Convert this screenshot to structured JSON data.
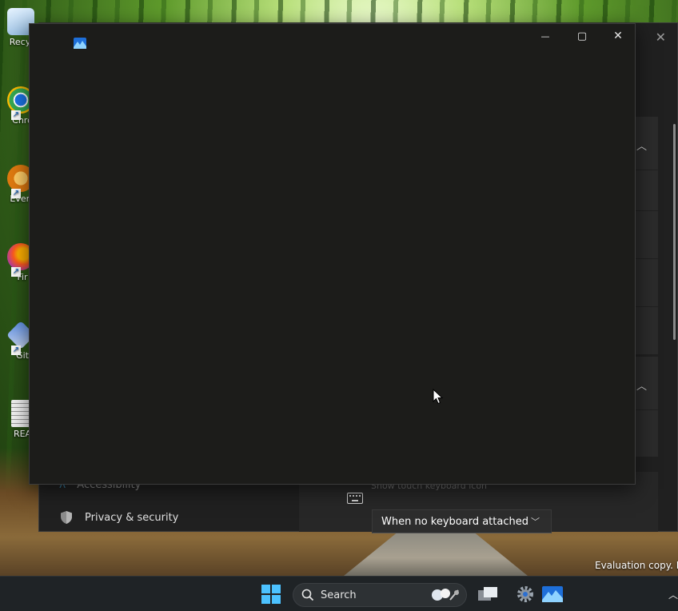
{
  "desktop": {
    "icons": [
      {
        "label": "Recyc",
        "icon": "recycle-bin-icon"
      },
      {
        "label": "Chro",
        "icon": "chrome-icon"
      },
      {
        "label": "Every",
        "icon": "everything-search-icon"
      },
      {
        "label": "Fir",
        "icon": "firefox-icon"
      },
      {
        "label": "Git",
        "icon": "git-icon"
      },
      {
        "label": "REA",
        "icon": "readme-file-icon"
      }
    ],
    "watermark": "Evaluation copy. Bu"
  },
  "settings_window": {
    "nav": [
      {
        "label": "Accessibility",
        "icon": "accessibility-icon"
      },
      {
        "label": "Privacy & security",
        "icon": "shield-icon"
      }
    ],
    "faded_setting_label": "Show touch keyboard icon",
    "dropdown_value": "When no keyboard attached"
  },
  "foreground_window": {
    "app_icon": "photos-app-icon",
    "controls": {
      "minimize": "—",
      "maximize": "▢",
      "close": "✕"
    }
  },
  "taskbar": {
    "search_placeholder": "Search",
    "items": [
      "start-button",
      "search-box",
      "task-view-button",
      "settings-app",
      "photos-app"
    ]
  },
  "colors": {
    "window_bg": "#1c1c1a",
    "settings_bg": "#202020",
    "taskbar_bg": "#1f2326",
    "accent": "#4cc2ff"
  }
}
